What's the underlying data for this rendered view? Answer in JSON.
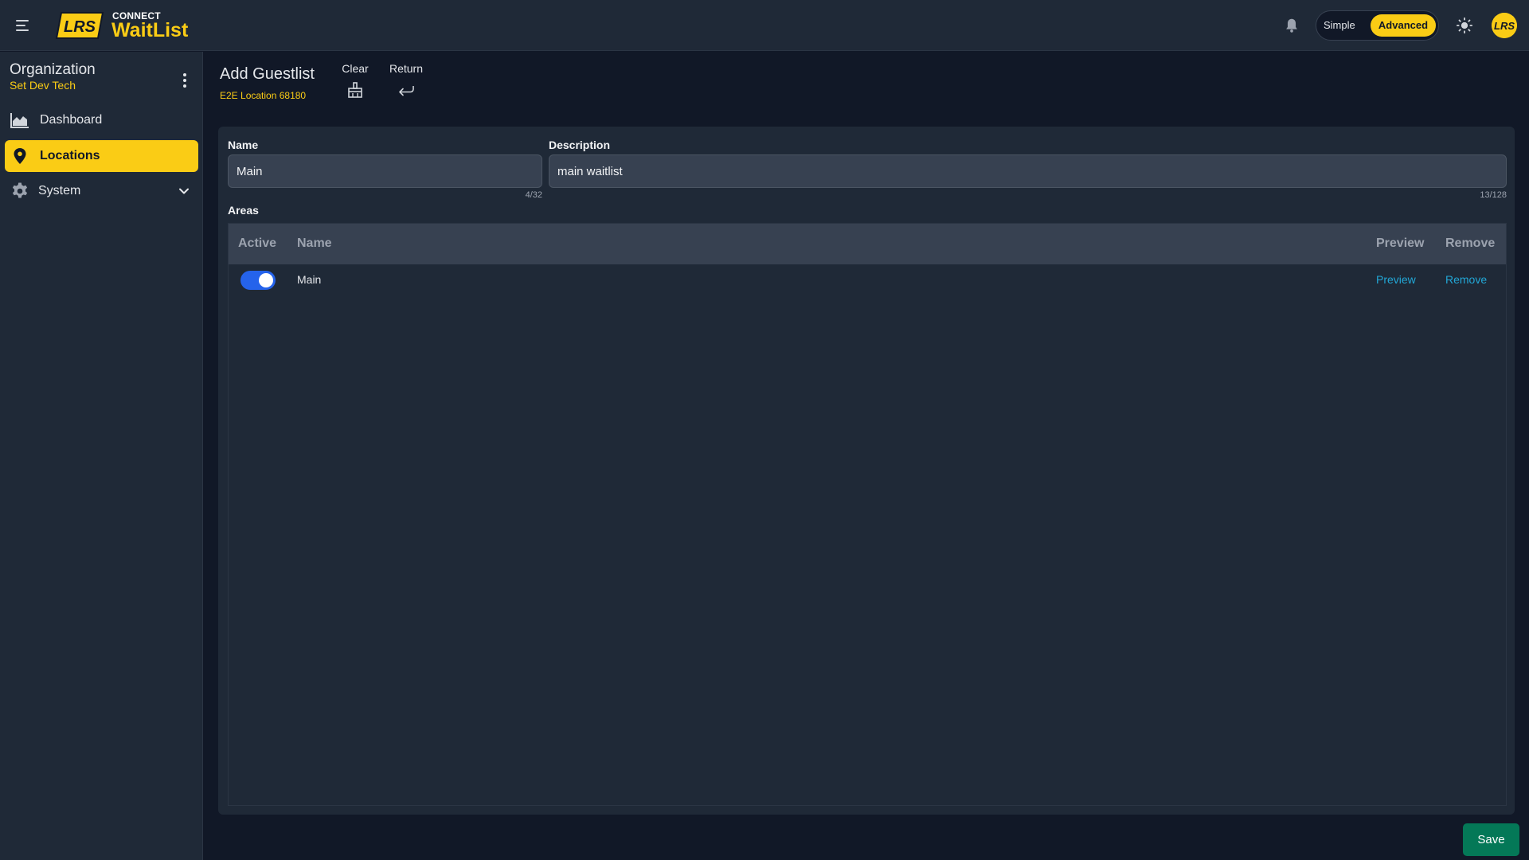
{
  "topbar": {
    "brand_small": "CONNECT",
    "brand_name": "WaitList",
    "logo_text": "LRS",
    "mode_simple": "Simple",
    "mode_advanced": "Advanced",
    "active_mode": "Advanced",
    "icons": [
      "menu-icon",
      "bell-icon",
      "sun-icon",
      "avatar"
    ]
  },
  "sidebar": {
    "org_title": "Organization",
    "org_name": "Set Dev Tech",
    "items": [
      {
        "label": "Dashboard",
        "icon": "area-chart-icon",
        "active": false
      },
      {
        "label": "Locations",
        "icon": "map-pin-icon",
        "active": true
      },
      {
        "label": "System",
        "icon": "gear-icon",
        "active": false,
        "expandable": true
      }
    ]
  },
  "header": {
    "title": "Add Guestlist",
    "subtitle": "E2E Location 68180",
    "clear_label": "Clear",
    "return_label": "Return"
  },
  "form": {
    "name_label": "Name",
    "name_value": "Main",
    "name_counter": "4/32",
    "description_label": "Description",
    "description_value": "main waitlist",
    "description_counter": "13/128",
    "areas_label": "Areas"
  },
  "table": {
    "columns": [
      "Active",
      "Name",
      "Preview",
      "Remove"
    ],
    "rows": [
      {
        "active": true,
        "name": "Main",
        "preview": "Preview",
        "remove": "Remove"
      }
    ]
  },
  "actions": {
    "save_label": "Save"
  },
  "colors": {
    "accent": "#facc15",
    "link": "#22a7d6",
    "toggle_on": "#2563eb",
    "save": "#047857"
  }
}
